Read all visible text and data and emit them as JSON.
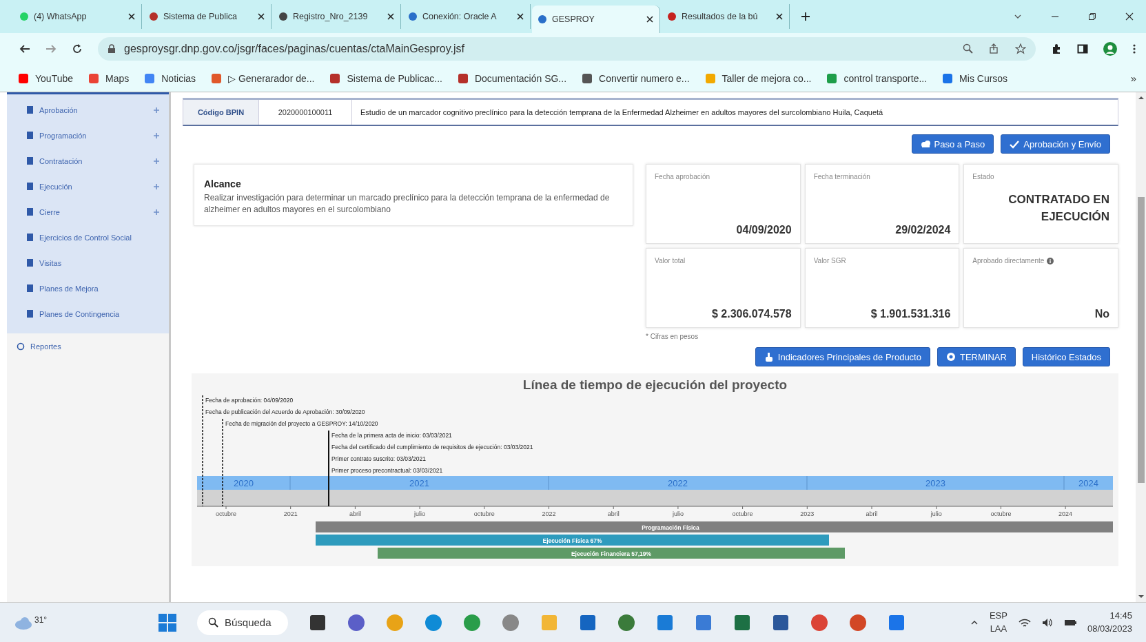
{
  "browser": {
    "tabs": [
      {
        "title": "(4) WhatsApp",
        "selected": false,
        "color": "#25d366"
      },
      {
        "title": "Sistema de Publica",
        "selected": false,
        "color": "#b5302a"
      },
      {
        "title": "Registro_Nro_2139",
        "selected": false,
        "color": "#444444"
      },
      {
        "title": "Conexión: Oracle A",
        "selected": false,
        "color": "#2a6fc9"
      },
      {
        "title": "GESPROY",
        "selected": true,
        "color": "#2a6fc9"
      },
      {
        "title": "Resultados de la bú",
        "selected": false,
        "color": "#c5221f"
      }
    ],
    "address": "gesproysgr.dnp.gov.co/jsgr/faces/paginas/cuentas/ctaMainGesproy.jsf",
    "bookmarks": [
      {
        "label": "YouTube",
        "color": "#ff0000"
      },
      {
        "label": "Maps",
        "color": "#ea4335"
      },
      {
        "label": "Noticias",
        "color": "#4285f4"
      },
      {
        "label": "▷ Generarador de...",
        "color": "#e0582a"
      },
      {
        "label": "Sistema de Publicac...",
        "color": "#b5302a"
      },
      {
        "label": "Documentación SG...",
        "color": "#b5302a"
      },
      {
        "label": "Convertir numero e...",
        "color": "#555555"
      },
      {
        "label": "Taller de mejora co...",
        "color": "#f2a900"
      },
      {
        "label": "control transporte...",
        "color": "#1e9e4a"
      },
      {
        "label": "Mis Cursos",
        "color": "#1a73e8"
      }
    ],
    "bookmarks_more": "»"
  },
  "sidebar": {
    "items": [
      {
        "label": "Aprobación",
        "expandable": true
      },
      {
        "label": "Programación",
        "expandable": true
      },
      {
        "label": "Contratación",
        "expandable": true
      },
      {
        "label": "Ejecución",
        "expandable": true
      },
      {
        "label": "Cierre",
        "expandable": true
      },
      {
        "label": "Ejercicios de Control Social",
        "expandable": false
      },
      {
        "label": "Visitas",
        "expandable": false
      },
      {
        "label": "Planes de Mejora",
        "expandable": false
      },
      {
        "label": "Planes de Contingencia",
        "expandable": false
      }
    ],
    "footer_item": {
      "label": "Reportes"
    }
  },
  "project": {
    "code_label": "Código BPIN",
    "code": "2020000100011",
    "name": "Estudio de un marcador cognitivo preclínico para la detección temprana de la Enfermedad Alzheimer en adultos mayores del surcolombiano Huila, Caquetá"
  },
  "top_actions": [
    "Paso a Paso",
    "Aprobación y Envío"
  ],
  "scope": {
    "title": "Alcance",
    "text": "Realizar investigación para determinar un marcado preclínico para la detección temprana de la enfermedad de alzheimer en adultos mayores en el surcolombiano"
  },
  "facts": [
    {
      "label": "Fecha aprobación",
      "value": "04/09/2020",
      "kind": "date"
    },
    {
      "label": "Fecha terminación",
      "value": "29/02/2024",
      "kind": "date"
    },
    {
      "label": "Estado",
      "value": "CONTRATADO EN EJECUCIÓN",
      "kind": "status"
    },
    {
      "label": "Valor total",
      "value": "$ 2.306.074.578",
      "kind": "money"
    },
    {
      "label": "Valor SGR",
      "value": "$ 1.901.531.316",
      "kind": "money"
    },
    {
      "label": "Aprobado directamente",
      "value": "No",
      "kind": "info"
    }
  ],
  "note": "* Cifras en pesos",
  "bottom_actions": [
    "Indicadores Principales de Producto",
    "TERMINAR",
    "Histórico Estados"
  ],
  "timeline": {
    "title": "Línea de tiempo de ejecución del proyecto",
    "markers": [
      {
        "kind": "dashed",
        "labels": [
          "Fecha de aprobación: 04/09/2020",
          "Fecha de publicación del Acuerdo de Aprobación: 30/09/2020"
        ]
      },
      {
        "kind": "dashed",
        "labels": [
          "Fecha de migración del proyecto a GESPROY: 14/10/2020"
        ]
      },
      {
        "kind": "solid",
        "labels": [
          "Fecha de la primera acta de inicio: 03/03/2021",
          "Fecha del certificado del cumplimiento de requisitos de ejecución: 03/03/2021",
          "Primer contrato suscrito: 03/03/2021",
          "Primer proceso precontractual: 03/03/2021"
        ]
      }
    ],
    "years": [
      "2020",
      "2021",
      "2022",
      "2023",
      "2024"
    ],
    "ticks": [
      "octubre",
      "2021",
      "abril",
      "julio",
      "octubre",
      "2022",
      "abril",
      "julio",
      "octubre",
      "2023",
      "abril",
      "julio",
      "octubre",
      "2024"
    ],
    "bars": [
      {
        "label": "Programación Física",
        "color": "#808080"
      },
      {
        "label": "Ejecución Física 67%",
        "color": "#2e9bbd"
      },
      {
        "label": "Ejecución Financiera 57,19%",
        "color": "#5e9a66"
      }
    ]
  },
  "taskbar": {
    "weather": "31°",
    "search": "Búsqueda",
    "language": "ESP",
    "layout": "LAA",
    "time": "14:45",
    "date": "08/03/2023"
  }
}
